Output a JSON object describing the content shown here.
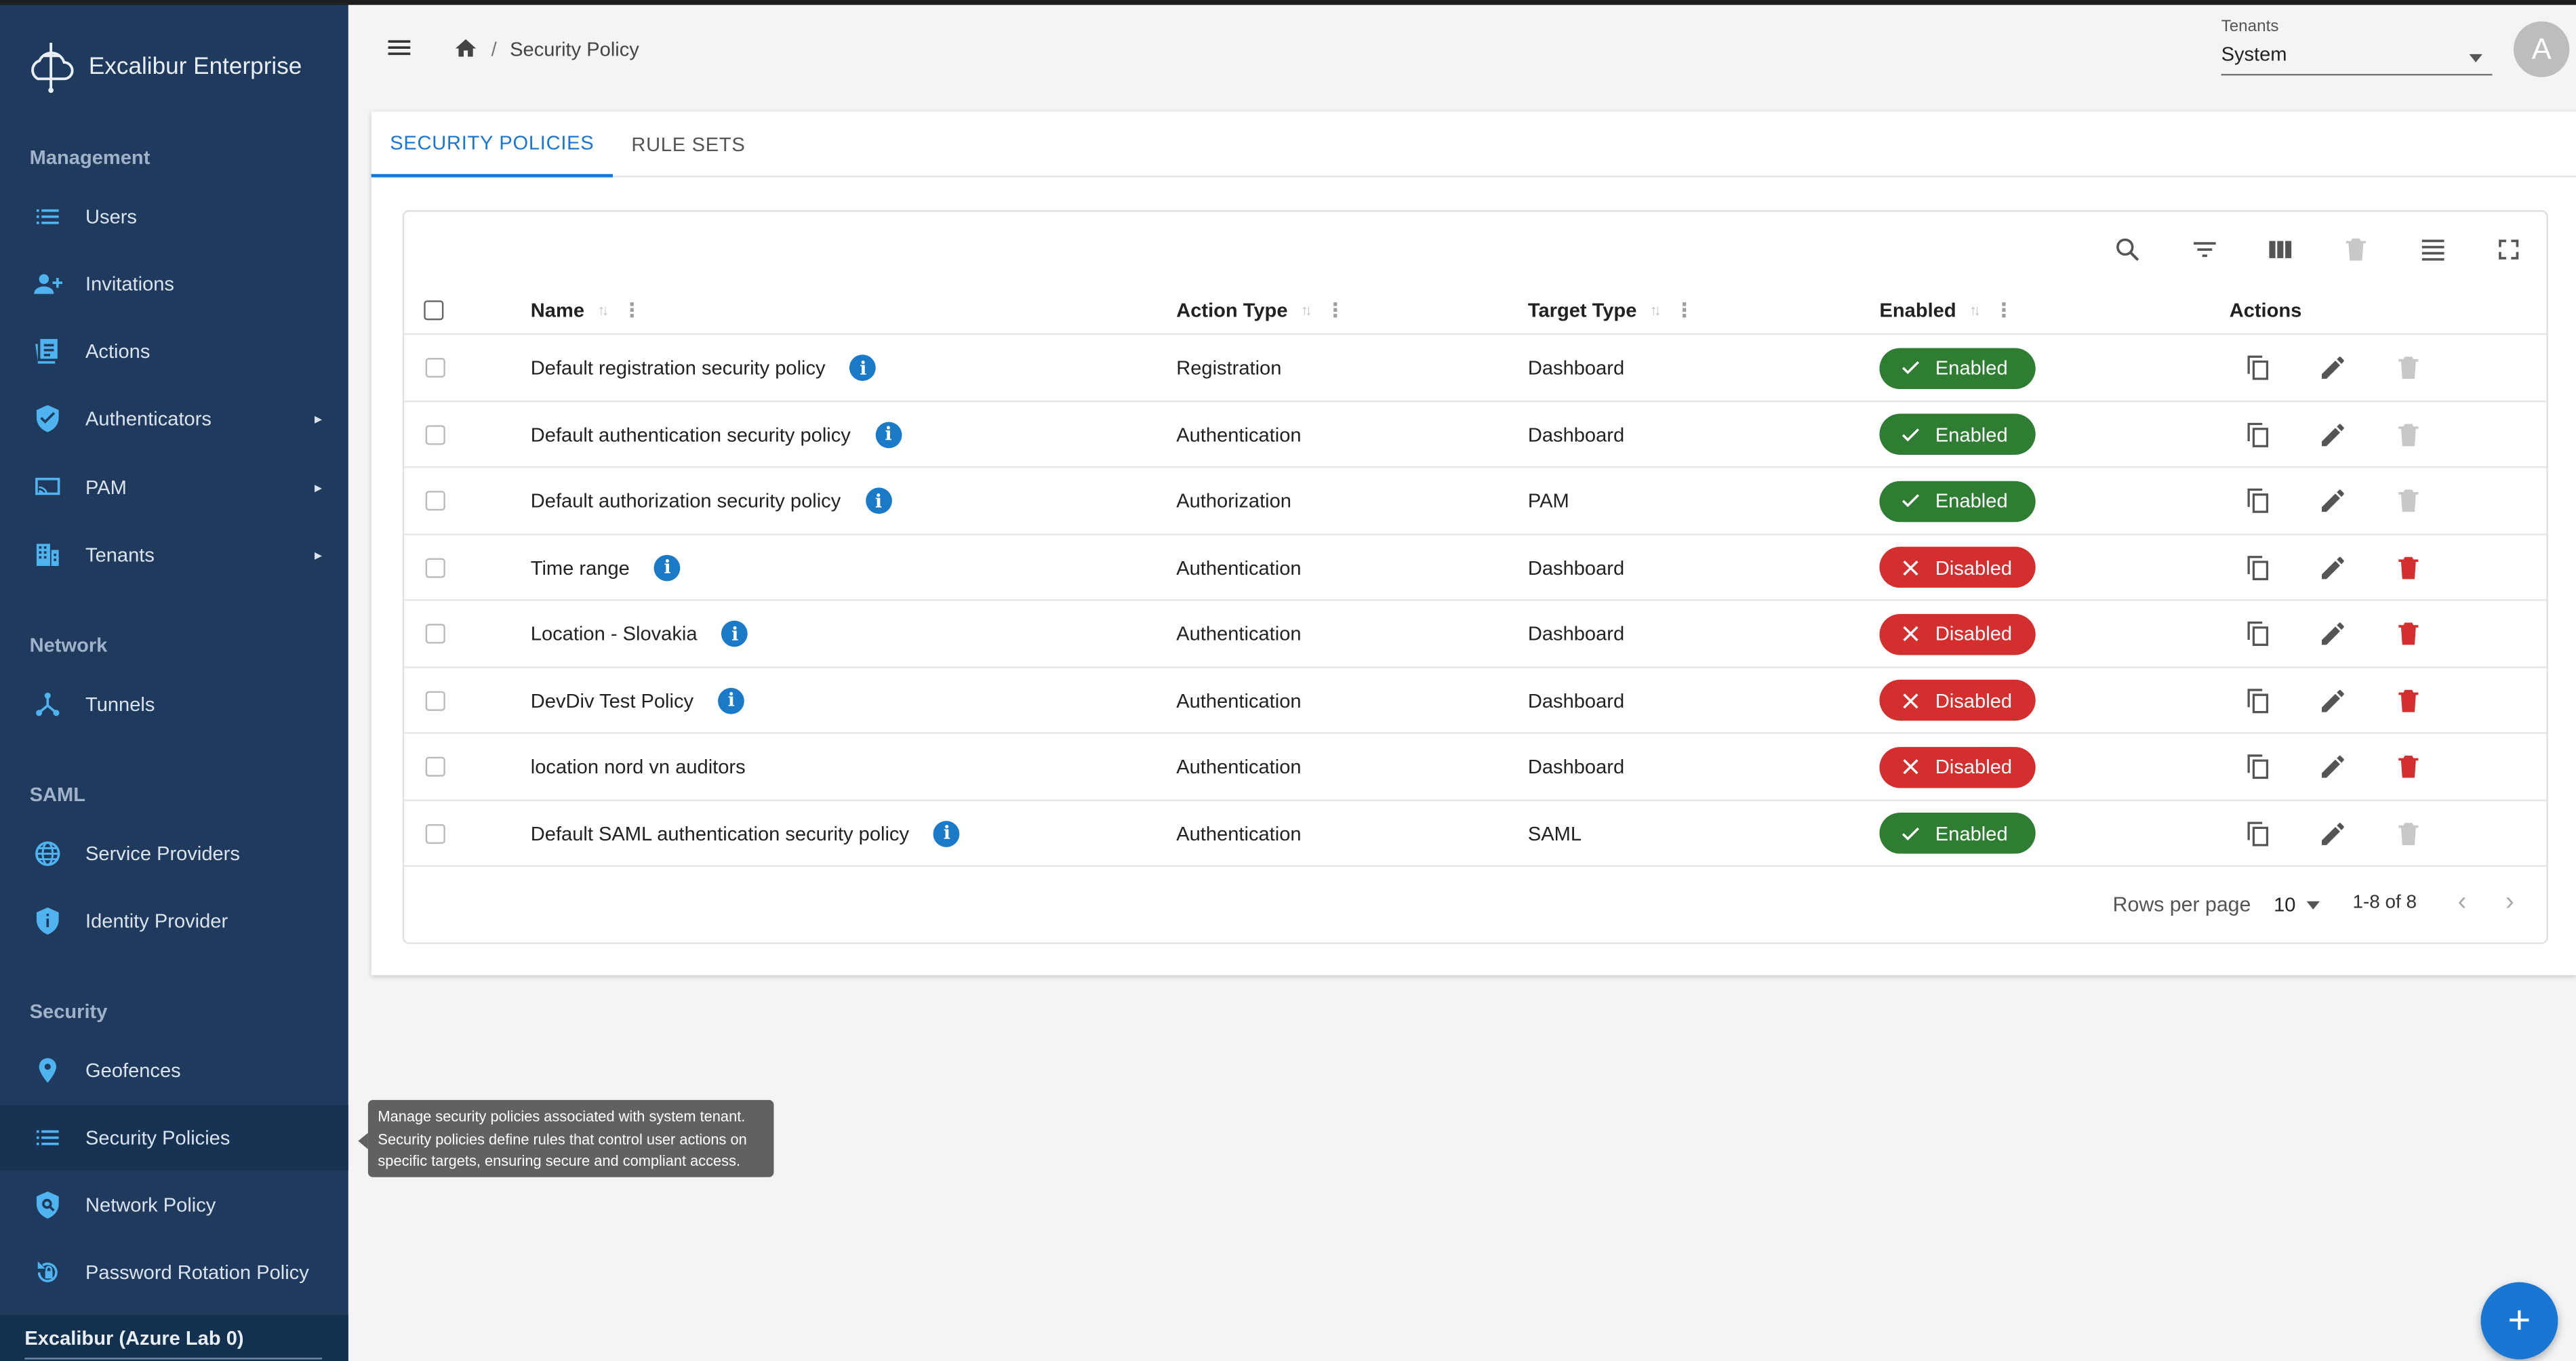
{
  "app": {
    "title": "Excalibur Enterprise"
  },
  "sidebar": {
    "sections": [
      {
        "title": "Management"
      },
      {
        "title": "Network"
      },
      {
        "title": "SAML"
      },
      {
        "title": "Security"
      }
    ],
    "items": [
      {
        "label": "Users",
        "icon": "list-icon"
      },
      {
        "label": "Invitations",
        "icon": "person-add-icon"
      },
      {
        "label": "Actions",
        "icon": "article-icon"
      },
      {
        "label": "Authenticators",
        "icon": "shield-check-icon",
        "expandable": true
      },
      {
        "label": "PAM",
        "icon": "screen-share-icon",
        "expandable": true
      },
      {
        "label": "Tenants",
        "icon": "building-icon",
        "expandable": true
      },
      {
        "label": "Tunnels",
        "icon": "hub-icon"
      },
      {
        "label": "Service Providers",
        "icon": "globe-icon"
      },
      {
        "label": "Identity Provider",
        "icon": "shield-info-icon"
      },
      {
        "label": "Geofences",
        "icon": "location-pin-icon"
      },
      {
        "label": "Security Policies",
        "icon": "list-icon",
        "active": true
      },
      {
        "label": "Network Policy",
        "icon": "shield-search-icon"
      },
      {
        "label": "Password Rotation Policy",
        "icon": "lock-reset-icon"
      }
    ],
    "footer": "Excalibur (Azure Lab 0)"
  },
  "header": {
    "breadcrumb": {
      "separator": "/",
      "current": "Security Policy"
    },
    "tenants": {
      "label": "Tenants",
      "value": "System"
    },
    "avatar_initial": "A"
  },
  "tabs": [
    {
      "label": "SECURITY POLICIES",
      "active": true
    },
    {
      "label": "RULE SETS",
      "active": false
    }
  ],
  "table": {
    "columns": {
      "name": "Name",
      "action_type": "Action Type",
      "target_type": "Target Type",
      "enabled": "Enabled",
      "actions": "Actions"
    },
    "rows": [
      {
        "name": "Default registration security policy",
        "info": true,
        "action_type": "Registration",
        "target_type": "Dashboard",
        "status": "Enabled",
        "deletable": false
      },
      {
        "name": "Default authentication security policy",
        "info": true,
        "action_type": "Authentication",
        "target_type": "Dashboard",
        "status": "Enabled",
        "deletable": false
      },
      {
        "name": "Default authorization security policy",
        "info": true,
        "action_type": "Authorization",
        "target_type": "PAM",
        "status": "Enabled",
        "deletable": false
      },
      {
        "name": "Time range",
        "info": true,
        "action_type": "Authentication",
        "target_type": "Dashboard",
        "status": "Disabled",
        "deletable": true
      },
      {
        "name": "Location - Slovakia",
        "info": true,
        "action_type": "Authentication",
        "target_type": "Dashboard",
        "status": "Disabled",
        "deletable": true
      },
      {
        "name": "DevDiv Test Policy",
        "info": true,
        "action_type": "Authentication",
        "target_type": "Dashboard",
        "status": "Disabled",
        "deletable": true
      },
      {
        "name": "location nord vn auditors",
        "info": false,
        "action_type": "Authentication",
        "target_type": "Dashboard",
        "status": "Disabled",
        "deletable": true
      },
      {
        "name": "Default SAML authentication security policy",
        "info": true,
        "action_type": "Authentication",
        "target_type": "SAML",
        "status": "Enabled",
        "deletable": false
      }
    ],
    "pagination": {
      "rows_per_page_label": "Rows per page",
      "rows_per_page": "10",
      "range": "1-8 of 8"
    }
  },
  "tooltip": "Manage security policies associated with system tenant. Security policies define rules that control user actions on specific targets, ensuring secure and compliant access.",
  "fab_label": "+",
  "colors": {
    "sidebar_bg": "#1f3a5c",
    "accent": "#1976d2",
    "enabled": "#2e7d32",
    "disabled": "#d32f2f",
    "info": "#1a7ac8"
  }
}
